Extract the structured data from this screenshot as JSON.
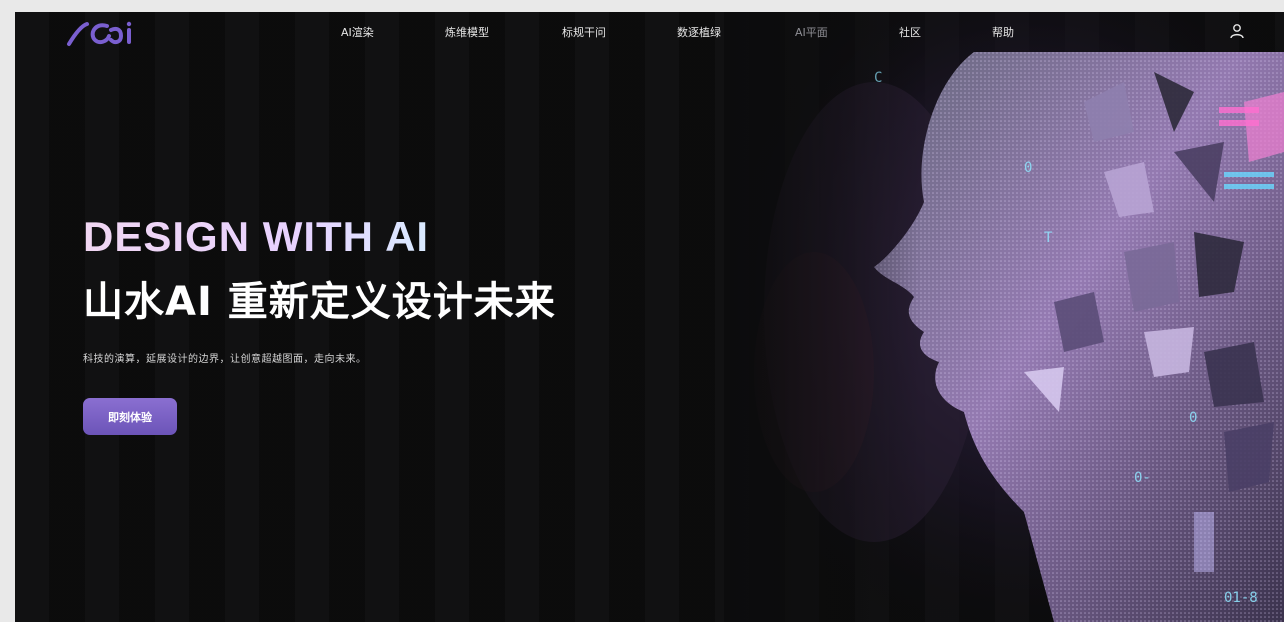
{
  "brand": {
    "logo_text": "sai",
    "accent": "#7a5fd0"
  },
  "nav": {
    "items": [
      "AI渲染",
      "炼维模型",
      "标规干问",
      "数逐植绿",
      "AI平面",
      "社区",
      "帮助"
    ],
    "dim_item": "AI平面",
    "user_icon": "user-icon"
  },
  "hero": {
    "title_en": "DESIGN WITH AI",
    "title_cn": "山水AI 重新定义设计未来",
    "subtitle": "科技的演算，延展设计的边界，让创意超越图面，走向未来。",
    "cta_label": "即刻体验"
  },
  "colors": {
    "background": "#0c0c0d",
    "cta_top": "#8a6fd1",
    "cta_bottom": "#6c54b8",
    "text": "#ffffff"
  }
}
